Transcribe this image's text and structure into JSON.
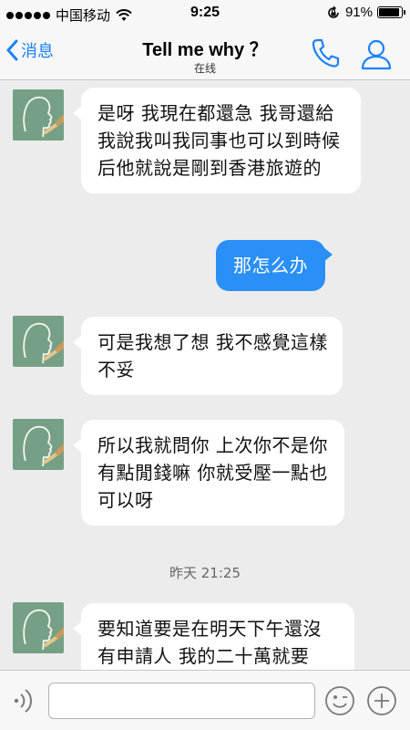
{
  "status_bar": {
    "carrier": "中国移动",
    "time": "9:25",
    "battery": "91%",
    "battery_level": 0.91
  },
  "nav": {
    "back_label": "消息",
    "title": "Tell me why ？",
    "subtitle": "在线",
    "call_icon": "phone-icon",
    "profile_icon": "person-icon"
  },
  "messages": [
    {
      "direction": "in",
      "text": "是呀  我現在都還急  我哥還給我說我叫我同事也可以到時候后他就說是剛到香港旅遊的"
    },
    {
      "direction": "out",
      "text": "那怎么办"
    },
    {
      "direction": "in",
      "text": "可是我想了想  我不感覺這樣不妥"
    },
    {
      "direction": "in",
      "text": "所以我就問你    上次你不是你有點閒錢嘛  你就受壓一點也可以呀"
    },
    {
      "direction": "in",
      "text": "要知道要是在明天下午還沒有申請人  我的二十萬就要"
    }
  ],
  "timestamp": "昨天 21:25",
  "input": {
    "value": "",
    "placeholder": ""
  },
  "icons": {
    "voice": "voice-icon",
    "emoji": "emoji-icon",
    "more": "plus-icon"
  },
  "colors": {
    "accent": "#1a82fb",
    "outgoing_bubble": "#2a8ff7",
    "avatar_bg": "#76a085"
  }
}
